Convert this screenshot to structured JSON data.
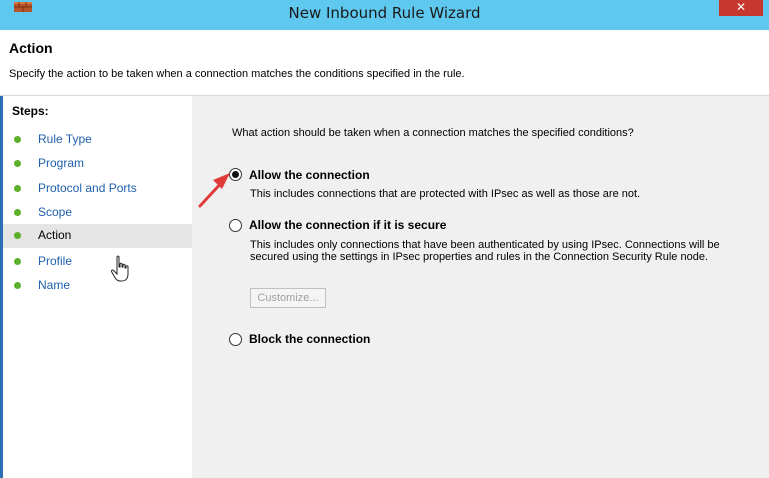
{
  "window": {
    "title": "New Inbound Rule Wizard",
    "close_glyph": "✕"
  },
  "header": {
    "title": "Action",
    "description": "Specify the action to be taken when a connection matches the conditions specified in the rule."
  },
  "steps": {
    "label": "Steps:",
    "items": [
      {
        "label": "Rule Type",
        "current": false
      },
      {
        "label": "Program",
        "current": false
      },
      {
        "label": "Protocol and Ports",
        "current": false
      },
      {
        "label": "Scope",
        "current": false
      },
      {
        "label": "Action",
        "current": true
      },
      {
        "label": "Profile",
        "current": false
      },
      {
        "label": "Name",
        "current": false
      }
    ]
  },
  "main": {
    "question": "What action should be taken when a connection matches the specified conditions?",
    "options": [
      {
        "label": "Allow the connection",
        "description": "This includes connections that are protected with IPsec as well as those are not.",
        "selected": true
      },
      {
        "label": "Allow the connection if it is secure",
        "description": "This includes only connections that have been authenticated by using IPsec.  Connections will be secured using the settings in IPsec properties and rules in the Connection Security Rule node.",
        "selected": false
      },
      {
        "label": "Block the connection",
        "description": "",
        "selected": false
      }
    ],
    "customize_label": "Customize..."
  },
  "colors": {
    "titlebar": "#5ec8ee",
    "step_dot": "#5caf2b",
    "step_link": "#1f5fae",
    "annotation_arrow": "#e03a3a"
  }
}
